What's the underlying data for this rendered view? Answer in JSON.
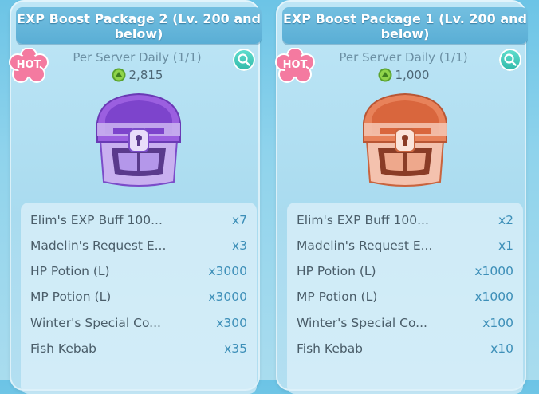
{
  "packages": [
    {
      "title": "EXP Boost Package 2 (Lv. 200 and below)",
      "badge": "HOT",
      "limit": "Per Server Daily (1/1)",
      "price": "2,815",
      "chest_color": "purple",
      "items": [
        {
          "name": "Elim's EXP Buff 100...",
          "qty": "x7"
        },
        {
          "name": "Madelin's Request E...",
          "qty": "x3"
        },
        {
          "name": "HP Potion (L)",
          "qty": "x3000"
        },
        {
          "name": "MP Potion (L)",
          "qty": "x3000"
        },
        {
          "name": "Winter's Special Co...",
          "qty": "x300"
        },
        {
          "name": "Fish Kebab",
          "qty": "x35"
        }
      ]
    },
    {
      "title": "EXP Boost Package 1 (Lv. 200 and below)",
      "badge": "HOT",
      "limit": "Per Server Daily (1/1)",
      "price": "1,000",
      "chest_color": "orange",
      "items": [
        {
          "name": "Elim's EXP Buff 100...",
          "qty": "x2"
        },
        {
          "name": "Madelin's Request E...",
          "qty": "x1"
        },
        {
          "name": "HP Potion (L)",
          "qty": "x1000"
        },
        {
          "name": "MP Potion (L)",
          "qty": "x1000"
        },
        {
          "name": "Winter's Special Co...",
          "qty": "x100"
        },
        {
          "name": "Fish Kebab",
          "qty": "x10"
        }
      ]
    }
  ],
  "icons": {
    "badge": "hot-badge-flower",
    "zoom": "magnifier-icon",
    "currency": "green-coin-icon",
    "chest": "treasure-chest-icon"
  },
  "colors": {
    "title_bar": "#5aaed5",
    "hot_badge": "#f47aa0",
    "zoom_button": "#2fb8a8",
    "quantity_text": "#3d8fb8",
    "coin": "#7cc43a",
    "chest_purple": "#9b5fe0",
    "chest_orange": "#e8825a"
  }
}
